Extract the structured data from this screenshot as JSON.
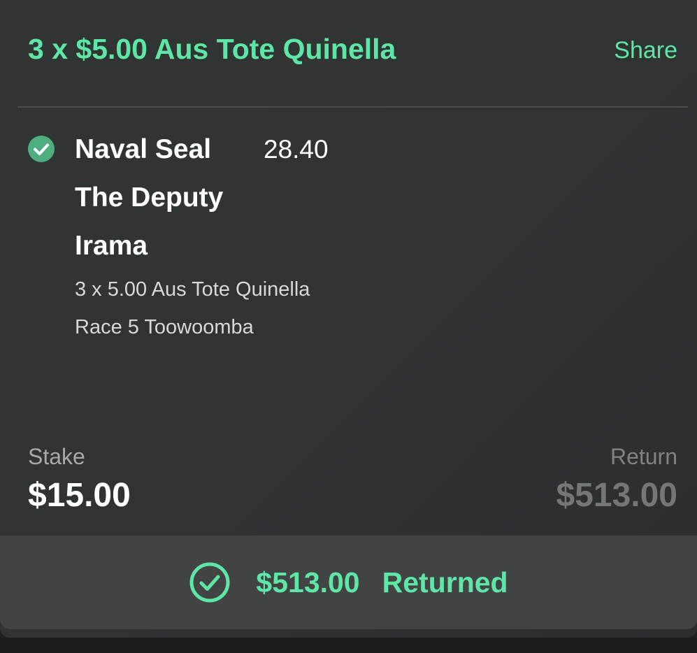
{
  "header": {
    "title": "3 x $5.00 Aus Tote Quinella",
    "share_label": "Share"
  },
  "selections": [
    {
      "name": "Naval Seal",
      "odds": "28.40",
      "status_icon": "check-circle-filled-icon"
    },
    {
      "name": "The Deputy"
    },
    {
      "name": "Irama"
    }
  ],
  "bet_details": {
    "bet_type": "3 x 5.00 Aus Tote Quinella",
    "race": "Race 5 Toowoomba"
  },
  "summary": {
    "stake_label": "Stake",
    "stake_value": "$15.00",
    "return_label": "Return",
    "return_value": "$513.00"
  },
  "result": {
    "icon": "check-circle-outline-icon",
    "amount": "$513.00",
    "label": "Returned"
  },
  "colors": {
    "accent": "#5ee6a6",
    "card_bg": "#313433",
    "result_bar_bg": "#414443",
    "check_fill": "#4fae7f"
  }
}
